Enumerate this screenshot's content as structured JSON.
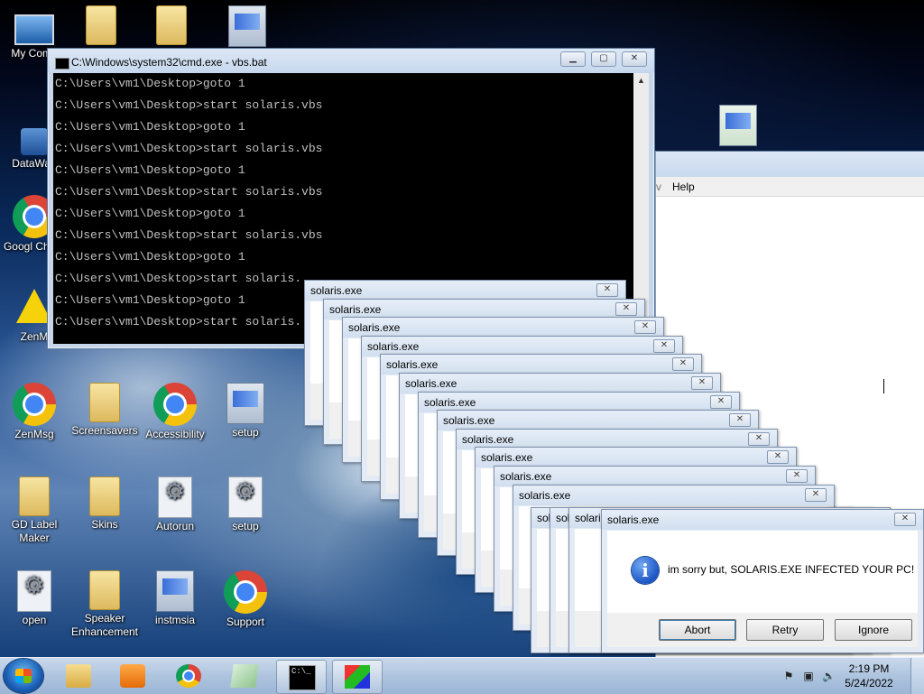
{
  "desktop_icons": [
    {
      "label": "My Comp",
      "icon": "computer-icon"
    },
    {
      "label": "",
      "icon": "folder-icon"
    },
    {
      "label": "",
      "icon": "folder-icon"
    },
    {
      "label": "",
      "icon": "setup-icon"
    },
    {
      "label": "DataWag",
      "icon": "shortcut-icon"
    },
    {
      "label": "Googl Chron",
      "icon": "chrome-icon"
    },
    {
      "label": "ZenM",
      "icon": "warning-icon"
    },
    {
      "label": "ZenMsg",
      "icon": "chrome-icon"
    },
    {
      "label": "Screensavers",
      "icon": "folder-icon"
    },
    {
      "label": "Accessibility",
      "icon": "chrome-icon"
    },
    {
      "label": "setup",
      "icon": "setup-icon"
    },
    {
      "label": "GD Label Maker",
      "icon": "folder-icon"
    },
    {
      "label": "Skins",
      "icon": "folder-icon"
    },
    {
      "label": "Autorun",
      "icon": "gear-file-icon"
    },
    {
      "label": "setup",
      "icon": "gear-file-icon"
    },
    {
      "label": "open",
      "icon": "gear-file-icon"
    },
    {
      "label": "Speaker Enhancement",
      "icon": "folder-icon"
    },
    {
      "label": "instmsia",
      "icon": "setup-icon"
    },
    {
      "label": "Support",
      "icon": "chrome-icon"
    }
  ],
  "cmd_window": {
    "title": "C:\\Windows\\system32\\cmd.exe - vbs.bat",
    "lines": [
      "C:\\Users\\vm1\\Desktop>goto 1",
      "C:\\Users\\vm1\\Desktop>start solaris.vbs",
      "C:\\Users\\vm1\\Desktop>goto 1",
      "C:\\Users\\vm1\\Desktop>start solaris.vbs",
      "C:\\Users\\vm1\\Desktop>goto 1",
      "C:\\Users\\vm1\\Desktop>start solaris.vbs",
      "C:\\Users\\vm1\\Desktop>goto 1",
      "C:\\Users\\vm1\\Desktop>start solaris.vbs",
      "C:\\Users\\vm1\\Desktop>goto 1",
      "C:\\Users\\vm1\\Desktop>start solaris.",
      "C:\\Users\\vm1\\Desktop>goto 1",
      "C:\\Users\\vm1\\Desktop>start solaris."
    ],
    "buttons": {
      "minimize": "▁",
      "maximize": "▢",
      "close": "✕"
    }
  },
  "background_app": {
    "menu": [
      "v",
      "Help"
    ]
  },
  "stacked_dialogs": {
    "title": "solaris.exe",
    "count": 15,
    "close": "✕"
  },
  "front_dialog": {
    "title": "solaris.exe",
    "message": "im sorry but, SOLARIS.EXE INFECTED YOUR PC!",
    "info_glyph": "i",
    "buttons": [
      "Abort",
      "Retry",
      "Ignore"
    ],
    "close": "✕"
  },
  "taskbar": {
    "pinned": [
      "explorer-icon",
      "media-player-icon",
      "chrome-icon",
      "notepad-icon",
      "cmd-icon",
      "cube-icon"
    ],
    "active": "cmd-icon",
    "cmd_glyph": "C:\\_",
    "clock_time": "2:19 PM",
    "clock_date": "5/24/2022",
    "tray_icons": [
      "action-center-icon",
      "network-icon",
      "volume-icon"
    ]
  }
}
